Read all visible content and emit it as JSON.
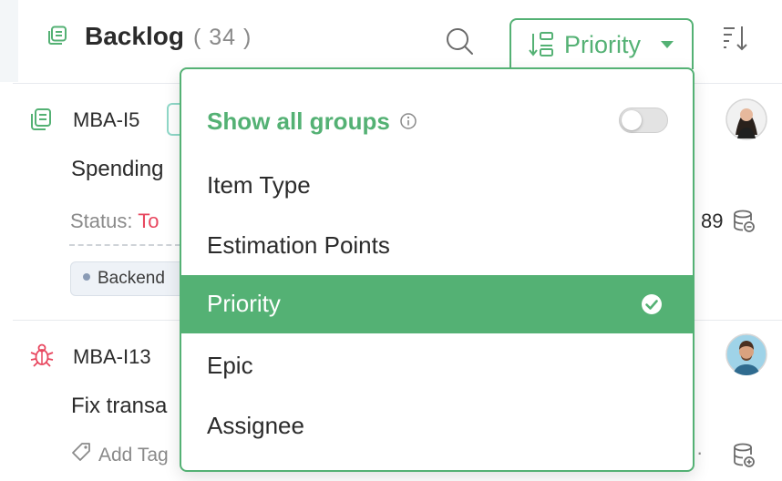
{
  "header": {
    "title": "Backlog",
    "count": "( 34 )",
    "group_by_label": "Priority"
  },
  "cards": [
    {
      "id": "MBA-I5",
      "title": "Spending",
      "status_label": "Status:",
      "status_value": "To",
      "points": "89",
      "tag": "Backend"
    },
    {
      "id": "MBA-I13",
      "title": "Fix transa",
      "add_tag_label": "Add Tag",
      "more": "·"
    }
  ],
  "dropdown": {
    "header": "Show all groups",
    "toggle_on": false,
    "options": [
      {
        "label": "Item Type",
        "selected": false
      },
      {
        "label": "Estimation Points",
        "selected": false
      },
      {
        "label": "Priority",
        "selected": true
      },
      {
        "label": "Epic",
        "selected": false
      },
      {
        "label": "Assignee",
        "selected": false
      }
    ]
  },
  "colors": {
    "accent": "#54b174",
    "status_red": "#e8475f",
    "bug_red": "#e8475f"
  },
  "icons": [
    "backlog-icon",
    "search-icon",
    "group-by-icon",
    "sort-icon",
    "story-icon",
    "bug-icon",
    "tag-icon",
    "estimation-icon",
    "info-icon",
    "check-circle-icon"
  ]
}
